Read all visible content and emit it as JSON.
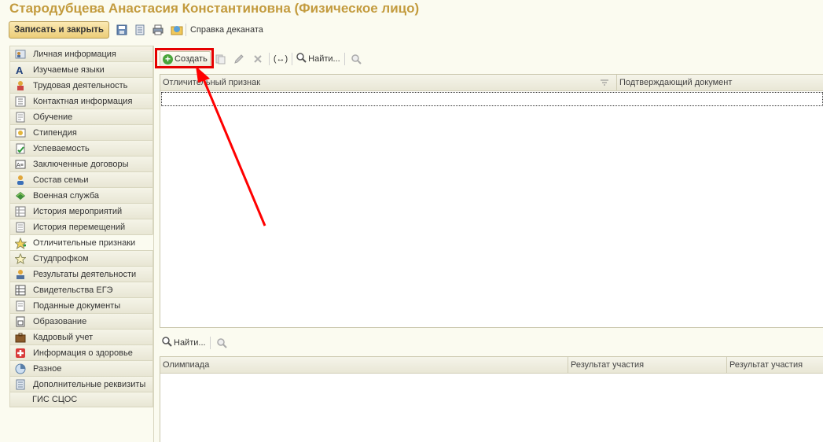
{
  "window": {
    "title": "Стародубцева Анастасия Константиновна (Физическое лицо)"
  },
  "toolbar": {
    "save_close_label": "Записать и закрыть",
    "icons": [
      "save-icon",
      "list-icon",
      "print-icon",
      "mail-icon"
    ],
    "dean_reference_label": "Справка деканата"
  },
  "sidebar": {
    "items": [
      {
        "label": "Личная информация",
        "icon": "person-card-icon"
      },
      {
        "label": "Изучаемые языки",
        "icon": "letter-a-icon"
      },
      {
        "label": "Трудовая деятельность",
        "icon": "worker-icon"
      },
      {
        "label": "Контактная информация",
        "icon": "contact-icon"
      },
      {
        "label": "Обучение",
        "icon": "document-icon"
      },
      {
        "label": "Стипендия",
        "icon": "coins-icon"
      },
      {
        "label": "Успеваемость",
        "icon": "checklist-icon"
      },
      {
        "label": "Заключенные договоры",
        "icon": "contract-icon"
      },
      {
        "label": "Состав семьи",
        "icon": "family-icon"
      },
      {
        "label": "Военная служба",
        "icon": "military-icon"
      },
      {
        "label": "История мероприятий",
        "icon": "history-icon"
      },
      {
        "label": "История перемещений",
        "icon": "moves-icon"
      },
      {
        "label": "Отличительные признаки",
        "icon": "star-icon"
      },
      {
        "label": "Студпрофком",
        "icon": "union-icon"
      },
      {
        "label": "Результаты деятельности",
        "icon": "results-icon"
      },
      {
        "label": "Свидетельства ЕГЭ",
        "icon": "certificate-icon"
      },
      {
        "label": "Поданные документы",
        "icon": "submitted-docs-icon"
      },
      {
        "label": "Образование",
        "icon": "education-icon"
      },
      {
        "label": "Кадровый учет",
        "icon": "briefcase-icon"
      },
      {
        "label": "Информация о здоровье",
        "icon": "health-icon"
      },
      {
        "label": "Разное",
        "icon": "misc-icon"
      },
      {
        "label": "Дополнительные реквизиты",
        "icon": "extra-props-icon"
      },
      {
        "label": "ГИС СЦОС",
        "icon": ""
      }
    ],
    "active_index": 12
  },
  "main_toolbar": {
    "create_label": "Создать",
    "find_label": "Найти...",
    "expand_label": "(↔)"
  },
  "table1": {
    "columns": [
      "Отличительный признак",
      "Подтверждающий документ"
    ]
  },
  "sub_toolbar": {
    "find_label": "Найти..."
  },
  "table2": {
    "columns": [
      "Олимпиада",
      "Результат участия",
      "Результат участия"
    ]
  },
  "annotation": {
    "highlight_color": "#e60000"
  }
}
